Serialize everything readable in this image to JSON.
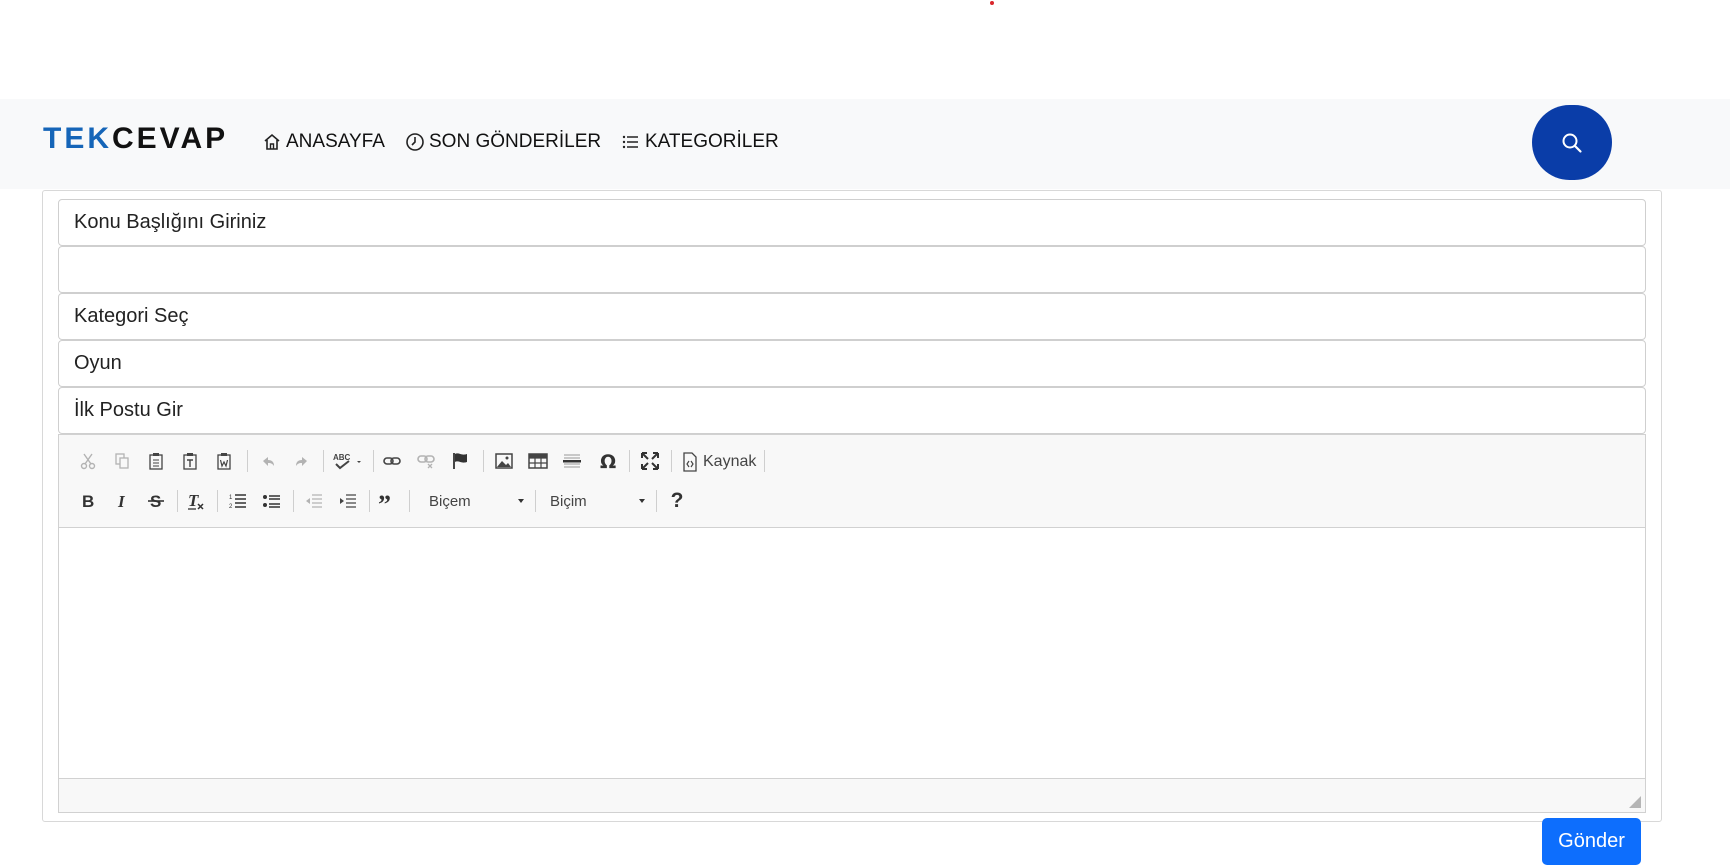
{
  "brand": {
    "part1": "TEK",
    "part2": "CEVAP"
  },
  "nav": {
    "items": [
      {
        "label": "ANASAYFA",
        "icon": "home-icon"
      },
      {
        "label": "SON GÖNDERİLER",
        "icon": "clock-icon"
      },
      {
        "label": "KATEGORİLER",
        "icon": "list-icon"
      }
    ],
    "search_icon": "search-icon"
  },
  "form": {
    "title_placeholder": "Konu Başlığını Giriniz",
    "title_value": "",
    "category_label": "Kategori Seç",
    "category_value": "Oyun",
    "first_post_label": "İlk Postu Gir"
  },
  "editor": {
    "row1": [
      "cut",
      "copy",
      "paste",
      "paste-text",
      "paste-word",
      "undo",
      "redo",
      "spellcheck",
      "link",
      "unlink",
      "anchor",
      "image",
      "table",
      "horizontal-line",
      "special-char",
      "maximize",
      "source"
    ],
    "source_label": "Kaynak",
    "row2": [
      "bold",
      "italic",
      "strike",
      "remove-format",
      "numbered-list",
      "bulleted-list",
      "outdent",
      "indent",
      "blockquote"
    ],
    "styles_label": "Biçem",
    "format_label": "Biçim",
    "help_label": "?"
  },
  "submit_label": "Gönder",
  "colors": {
    "accent": "#0d6efd",
    "search_button": "#0a3da8",
    "brand_blue": "#1565b8"
  }
}
